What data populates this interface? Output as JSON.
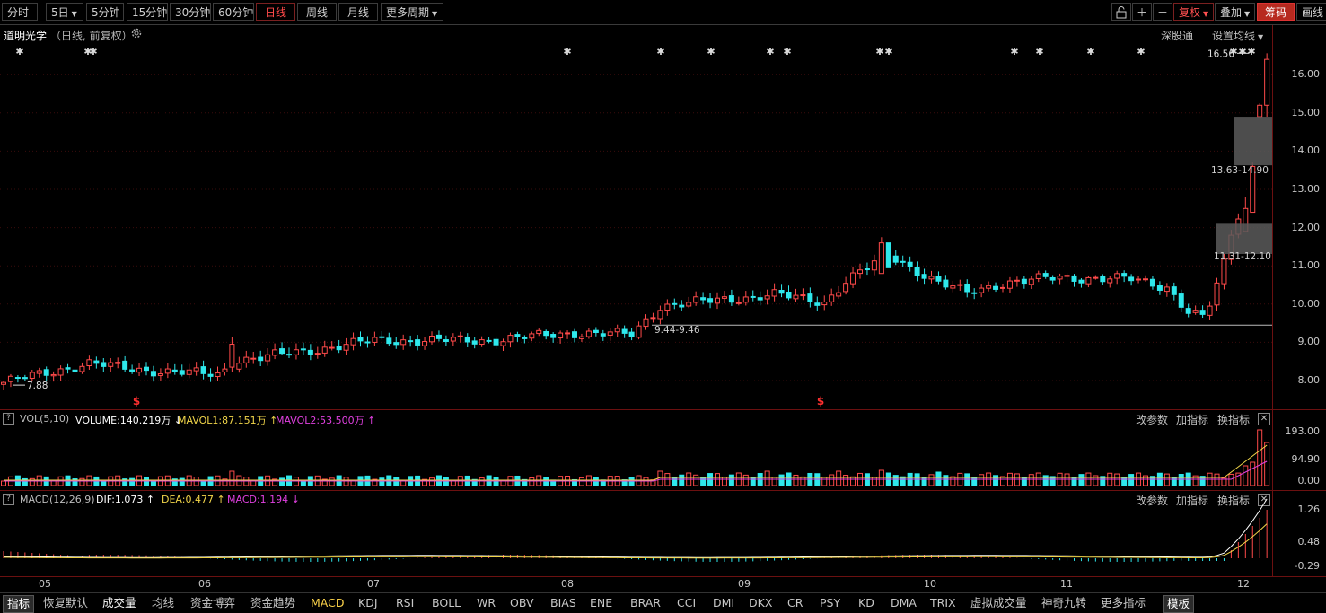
{
  "toolbar": {
    "periods": [
      "分时",
      "5日",
      "5分钟",
      "15分钟",
      "30分钟",
      "60分钟",
      "日线",
      "周线",
      "月线",
      "更多周期"
    ],
    "active_period": "日线",
    "right": {
      "fuquan": "复权",
      "diejia": "叠加",
      "chouma": "筹码",
      "huaxian": "画线"
    }
  },
  "main": {
    "stock_name": "道明光学",
    "mode": "（日线, 前复权）",
    "links": {
      "shenfu": "深股通",
      "ma_setting": "设置均线"
    },
    "y_ticks": [
      "16.00",
      "15.00",
      "14.00",
      "13.00",
      "12.00",
      "11.00",
      "10.00",
      "9.00",
      "8.00"
    ],
    "annotations": {
      "high": "16.56",
      "low": "7.88",
      "gap1": "13.63-14.90",
      "gap2": "11.31-12.10",
      "gap3": "9.44-9.46"
    }
  },
  "vol": {
    "label": "VOL(5,10)",
    "volume": "VOLUME:140.219万",
    "mavol1": "MAVOL1:87.151万",
    "mavol2": "MAVOL2:53.500万",
    "y_ticks": [
      "193.00",
      "94.90",
      "0.00"
    ],
    "options": [
      "改参数",
      "加指标",
      "换指标"
    ]
  },
  "macd": {
    "label": "MACD(12,26,9)",
    "dif": "DIF:1.073",
    "dea": "DEA:0.477",
    "macd": "MACD:1.194",
    "y_ticks": [
      "1.26",
      "0.48",
      "-0.29"
    ],
    "options": [
      "改参数",
      "加指标",
      "换指标"
    ]
  },
  "x_axis": [
    "05",
    "06",
    "07",
    "08",
    "09",
    "10",
    "11",
    "12"
  ],
  "bottom": {
    "items": [
      "指标",
      "恢复默认",
      "成交量",
      "均线",
      "资金博弈",
      "资金趋势",
      "MACD",
      "KDJ",
      "RSI",
      "BOLL",
      "WR",
      "OBV",
      "BIAS",
      "ENE",
      "BRAR",
      "CCI",
      "DMI",
      "DKX",
      "CR",
      "PSY",
      "KD",
      "DMA",
      "TRIX",
      "虚拟成交量",
      "神奇九转",
      "更多指标"
    ],
    "template": "模板"
  },
  "colors": {
    "up": "#ff4a4a",
    "down": "#2ee8ec",
    "ma1": "#ffffff",
    "ma2": "#f2d64a",
    "ma3": "#e040e0"
  }
}
